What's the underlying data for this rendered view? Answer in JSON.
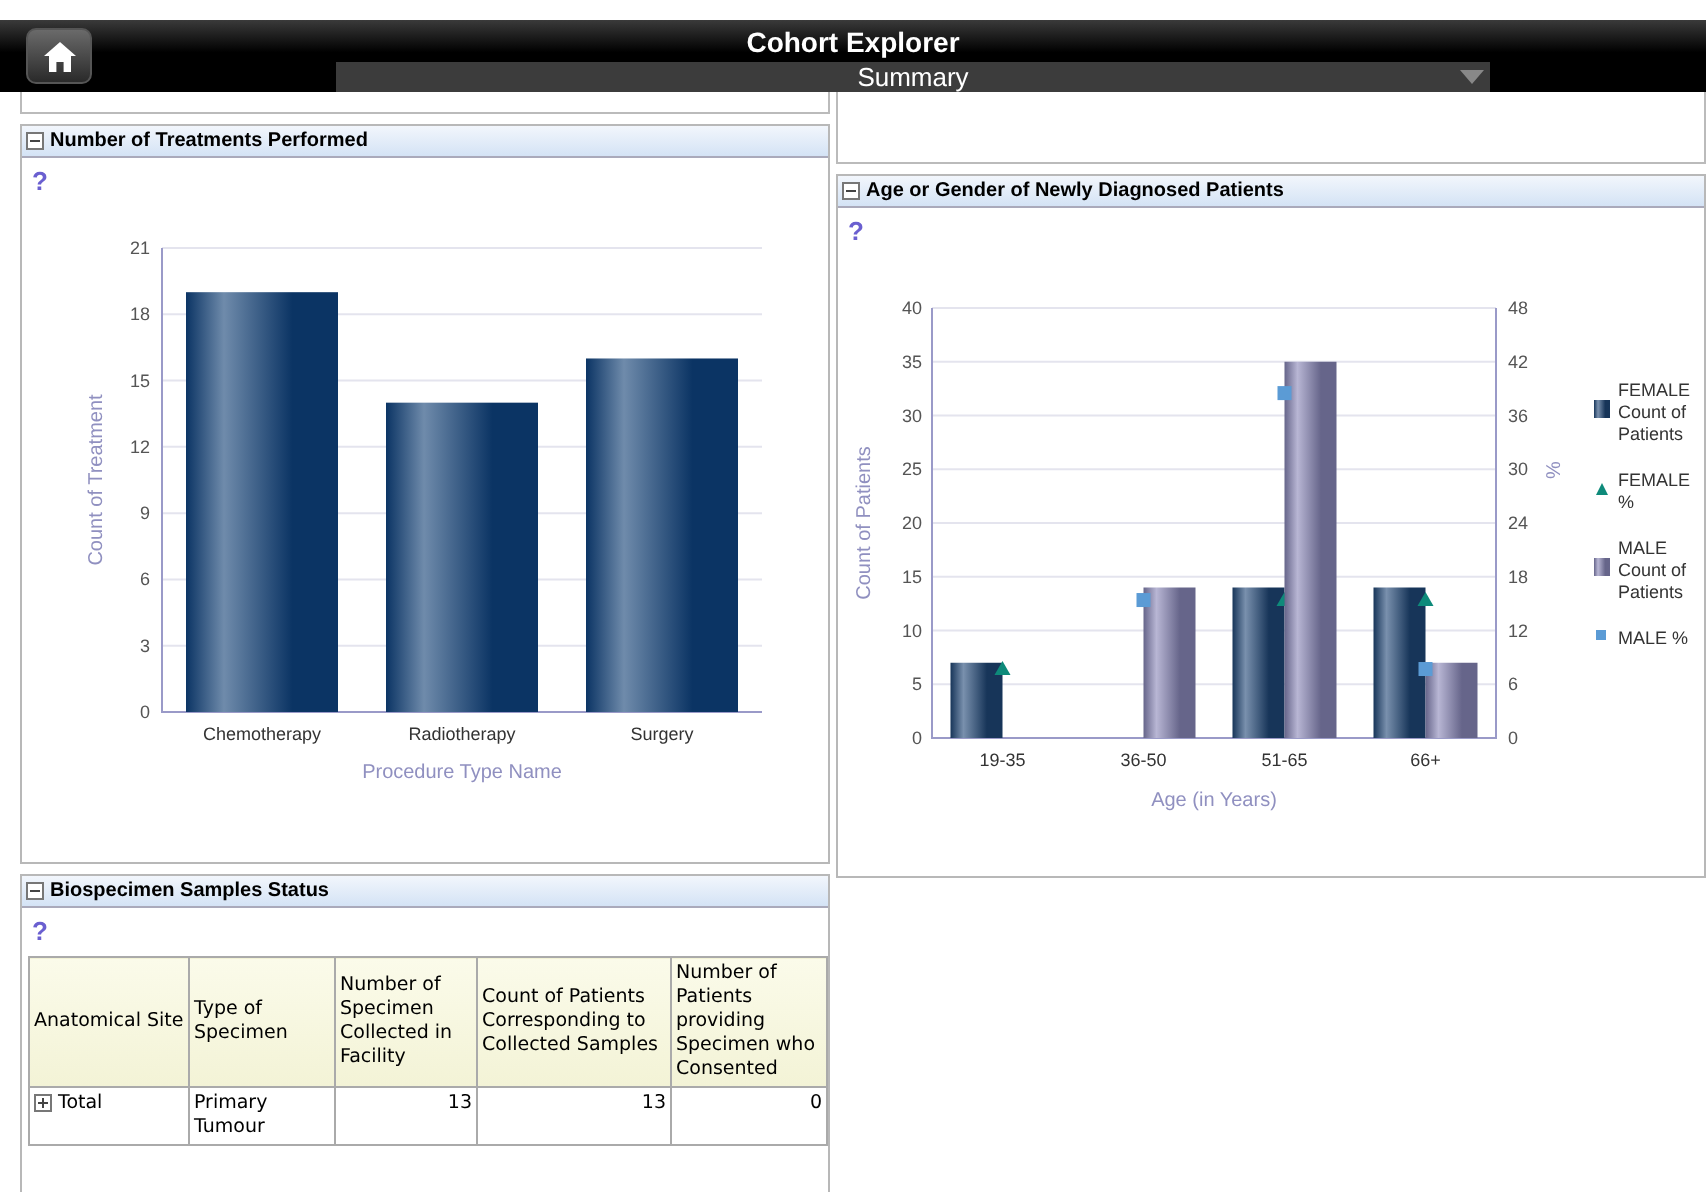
{
  "header": {
    "title": "Cohort Explorer",
    "view_select": {
      "value": "Summary"
    }
  },
  "left_column": {
    "panels": [
      {
        "kind": "empty"
      },
      {
        "kind": "chart",
        "title": "Number of Treatments Performed",
        "expanded": true,
        "help": "?",
        "chart_data": {
          "type": "bar",
          "xlabel": "Procedure Type Name",
          "ylabel": "Count of Treatment",
          "categories": [
            "Chemotherapy",
            "Radiotherapy",
            "Surgery"
          ],
          "values": [
            19,
            14,
            16
          ],
          "grid": true,
          "ylim": [
            0,
            21
          ],
          "yticks": [
            0,
            3,
            6,
            9,
            12,
            15,
            18,
            21
          ]
        }
      },
      {
        "kind": "table",
        "title": "Biospecimen Samples Status",
        "expanded": true,
        "help": "?",
        "columns": [
          "Anatomical Site",
          "Type of Specimen",
          "Number of Specimen Collected in Facility",
          "Count of Patients Corresponding to Collected Samples",
          "Number of Patients providing Specimen who Consented"
        ],
        "rows": [
          {
            "expanded": false,
            "cells": [
              "Total",
              "Primary Tumour",
              "13",
              "13",
              "0"
            ]
          }
        ]
      }
    ]
  },
  "right_column": {
    "panels": [
      {
        "kind": "empty"
      },
      {
        "kind": "chart",
        "title": "Age or Gender of Newly Diagnosed Patients",
        "expanded": true,
        "help": "?",
        "chart_data": {
          "type": "bar",
          "xlabel": "Age (in Years)",
          "ylabel": "Count of Patients",
          "y2label": "%",
          "categories": [
            "19-35",
            "36-50",
            "51-65",
            "66+"
          ],
          "grid": true,
          "legend": true,
          "series": [
            {
              "name": "FEMALE Count of Patients",
              "color": "#1f4677",
              "values": [
                7,
                null,
                14,
                14
              ]
            },
            {
              "name": "FEMALE %",
              "type": "scatter",
              "marker": "triangle",
              "axis": "y2",
              "color": "#0e8a7a",
              "values": [
                7.7,
                null,
                15.4,
                15.4
              ]
            },
            {
              "name": "MALE Count of Patients",
              "color": "#8886b8",
              "values": [
                null,
                14,
                35,
                7
              ]
            },
            {
              "name": "MALE %",
              "type": "scatter",
              "marker": "square",
              "axis": "y2",
              "color": "#5b9bd5",
              "values": [
                null,
                15.4,
                38.5,
                7.7
              ]
            }
          ],
          "ylim": [
            0,
            40
          ],
          "yticks": [
            0,
            5,
            10,
            15,
            20,
            25,
            30,
            35,
            40
          ],
          "y2lim": [
            0,
            48
          ],
          "y2ticks": [
            0,
            6,
            12,
            18,
            24,
            30,
            36,
            42,
            48
          ]
        }
      }
    ]
  }
}
